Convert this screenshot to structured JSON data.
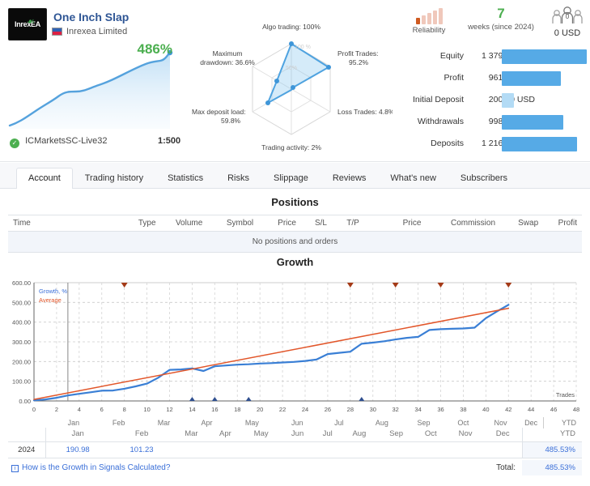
{
  "header": {
    "logo_text": "InrexEA",
    "signal_name": "One Inch Slap",
    "author": "Inrexea Limited",
    "growth_percent": "486%",
    "broker": "ICMarketsSC-Live32",
    "leverage": "1:500",
    "verified_icon": "check-icon"
  },
  "radar": {
    "scale_labels": [
      "100 %",
      "50%"
    ],
    "axes": [
      {
        "label": "Algo trading: 100%",
        "value": 100
      },
      {
        "label": "Profit Trades:\n95.2%",
        "value": 95.2
      },
      {
        "label": "Loss Trades: 4.8%",
        "value": 4.8
      },
      {
        "label": "Trading activity: 2%",
        "value": 2
      },
      {
        "label": "Max deposit load:\n59.8%",
        "value": 59.8
      },
      {
        "label": "Maximum\ndrawdown: 36.6%",
        "value": 36.6
      }
    ]
  },
  "badges": {
    "reliability_label": "Reliability",
    "reliability_level": 1,
    "weeks_value": "7",
    "weeks_label": "weeks (since 2024)",
    "subscribers_count": "0",
    "subscribers_value": "0 USD"
  },
  "stats": [
    {
      "name": "Equity",
      "value": "1 379.17 USD",
      "bar_pct": 100,
      "light": false
    },
    {
      "name": "Profit",
      "value": "961.67 USD",
      "bar_pct": 69.7,
      "light": false
    },
    {
      "name": "Initial Deposit",
      "value": "200.00 USD",
      "bar_pct": 14.5,
      "light": true
    },
    {
      "name": "Withdrawals",
      "value": "998.80 USD",
      "bar_pct": 72.4,
      "light": false
    },
    {
      "name": "Deposits",
      "value": "1 216.30 USD",
      "bar_pct": 88.2,
      "light": false
    }
  ],
  "tabs": [
    {
      "label": "Account",
      "active": true
    },
    {
      "label": "Trading history",
      "active": false
    },
    {
      "label": "Statistics",
      "active": false
    },
    {
      "label": "Risks",
      "active": false
    },
    {
      "label": "Slippage",
      "active": false
    },
    {
      "label": "Reviews",
      "active": false
    },
    {
      "label": "What's new",
      "active": false
    },
    {
      "label": "Subscribers",
      "active": false
    }
  ],
  "positions": {
    "title": "Positions",
    "columns": [
      "Time",
      "Type",
      "Volume",
      "Symbol",
      "Price",
      "S/L",
      "T/P",
      "Price",
      "Commission",
      "Swap",
      "Profit"
    ],
    "empty_text": "No positions and orders"
  },
  "growth": {
    "title": "Growth",
    "trades_axis_label": "Trades"
  },
  "chart_data": {
    "type": "line",
    "title": "Growth",
    "xlabel": "Trades",
    "ylabel": "Growth, %",
    "xlim": [
      0,
      48
    ],
    "ylim": [
      0,
      600
    ],
    "xticks": [
      0,
      2,
      4,
      6,
      8,
      10,
      12,
      14,
      16,
      18,
      20,
      22,
      24,
      26,
      28,
      30,
      32,
      34,
      36,
      38,
      40,
      42,
      44,
      46,
      48
    ],
    "yticks": [
      "0.00",
      "100.00",
      "200.00",
      "300.00",
      "400.00",
      "500.00",
      "600.00"
    ],
    "month_ticks": [
      {
        "label": "Jan",
        "x": 3.5
      },
      {
        "label": "Feb",
        "x": 7.5
      },
      {
        "label": "Mar",
        "x": 11.5
      },
      {
        "label": "Apr",
        "x": 15.3
      },
      {
        "label": "May",
        "x": 19.3
      },
      {
        "label": "Jun",
        "x": 23.3
      },
      {
        "label": "Jul",
        "x": 27.0
      },
      {
        "label": "Aug",
        "x": 30.8
      },
      {
        "label": "Sep",
        "x": 34.5
      },
      {
        "label": "Oct",
        "x": 38.0
      },
      {
        "label": "Nov",
        "x": 41.3
      },
      {
        "label": "Dec",
        "x": 44.0
      }
    ],
    "grid": true,
    "legend_position": "top-left",
    "series": [
      {
        "name": "Growth, %",
        "color": "#3a7fd5",
        "points": [
          [
            0,
            3
          ],
          [
            1,
            8
          ],
          [
            2,
            16
          ],
          [
            3,
            28
          ],
          [
            4,
            36
          ],
          [
            5,
            44
          ],
          [
            6,
            52
          ],
          [
            7,
            53
          ],
          [
            8,
            62
          ],
          [
            9,
            74
          ],
          [
            10,
            88
          ],
          [
            11,
            118
          ],
          [
            12,
            158
          ],
          [
            13,
            160
          ],
          [
            14,
            165
          ],
          [
            15,
            152
          ],
          [
            16,
            176
          ],
          [
            17,
            180
          ],
          [
            18,
            184
          ],
          [
            19,
            186
          ],
          [
            20,
            190
          ],
          [
            21,
            192
          ],
          [
            22,
            195
          ],
          [
            23,
            198
          ],
          [
            24,
            203
          ],
          [
            25,
            210
          ],
          [
            26,
            238
          ],
          [
            27,
            244
          ],
          [
            28,
            250
          ],
          [
            29,
            290
          ],
          [
            30,
            296
          ],
          [
            31,
            303
          ],
          [
            32,
            312
          ],
          [
            33,
            320
          ],
          [
            34,
            325
          ],
          [
            35,
            360
          ],
          [
            36,
            364
          ],
          [
            37,
            366
          ],
          [
            38,
            368
          ],
          [
            39,
            372
          ],
          [
            40,
            420
          ],
          [
            41,
            455
          ],
          [
            42,
            488
          ]
        ]
      },
      {
        "name": "Average",
        "color": "#e2562a",
        "points": [
          [
            0,
            8
          ],
          [
            42,
            470
          ]
        ]
      }
    ],
    "annotations": {
      "top_markers_color": "#a43a17",
      "top_markers_x": [
        8,
        28,
        32,
        36,
        42
      ],
      "bottom_markers_color": "#2f4f8f",
      "bottom_markers_x": [
        14,
        16,
        19,
        29
      ]
    }
  },
  "monthly": {
    "year_col_header": "",
    "months": [
      "Jan",
      "Feb",
      "Mar",
      "Apr",
      "May",
      "Jun",
      "Jul",
      "Aug",
      "Sep",
      "Oct",
      "Nov",
      "Dec"
    ],
    "ytd_header": "YTD",
    "rows": [
      {
        "year": "2024",
        "values": [
          "190.98",
          "101.23",
          "",
          "",
          "",
          "",
          "",
          "",
          "",
          "",
          "",
          ""
        ],
        "ytd": "485.53%"
      }
    ],
    "faq_link": "How is the Growth in Signals Calculated?",
    "total_label": "Total:",
    "total_value": "485.53%"
  },
  "colors": {
    "accent_blue": "#3a7fd5",
    "bar_blue": "#56aae6",
    "bar_blue_light": "#b3dbf5",
    "green": "#4caf50",
    "link": "#3a6fd8",
    "red_line": "#e2562a"
  }
}
